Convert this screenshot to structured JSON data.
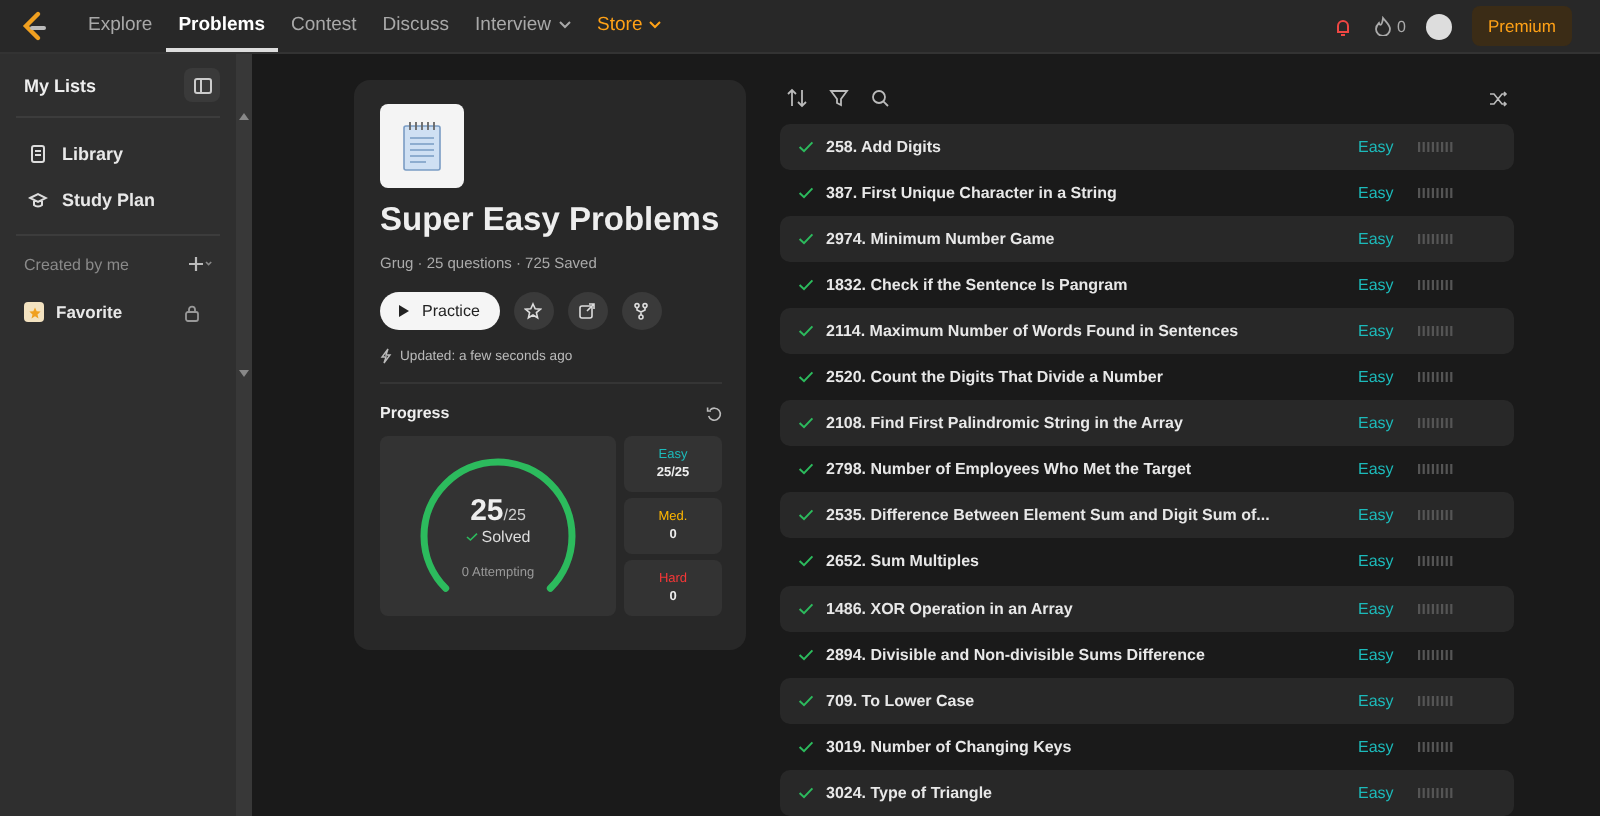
{
  "nav": {
    "items": [
      {
        "label": "Explore",
        "selected": false,
        "dropdown": false,
        "highlight": false
      },
      {
        "label": "Problems",
        "selected": true,
        "dropdown": false,
        "highlight": false
      },
      {
        "label": "Contest",
        "selected": false,
        "dropdown": false,
        "highlight": false
      },
      {
        "label": "Discuss",
        "selected": false,
        "dropdown": false,
        "highlight": false
      },
      {
        "label": "Interview",
        "selected": false,
        "dropdown": true,
        "highlight": false
      },
      {
        "label": "Store",
        "selected": false,
        "dropdown": true,
        "highlight": true
      }
    ],
    "streak": "0",
    "premium": "Premium"
  },
  "sidebar": {
    "title": "My Lists",
    "items": [
      {
        "label": "Library",
        "kind": "library"
      },
      {
        "label": "Study Plan",
        "kind": "studyplan"
      }
    ],
    "section": "Created by me",
    "lists": [
      {
        "label": "Favorite",
        "locked": true
      }
    ]
  },
  "card": {
    "title": "Super Easy Problems",
    "meta": "Grug · 25 questions · 725 Saved",
    "practice": "Practice",
    "updated": "Updated: a few seconds ago",
    "progress": {
      "title": "Progress",
      "solved": "25",
      "total": "/25",
      "solved_label": "Solved",
      "attempting": "0 Attempting",
      "level": 1,
      "counts": [
        {
          "label": "Easy",
          "value": "25/25",
          "color": "#1cbaba"
        },
        {
          "label": "Med.",
          "value": "0",
          "color": "#ffb700"
        },
        {
          "label": "Hard",
          "value": "0",
          "color": "#f63737"
        }
      ]
    }
  },
  "problems": [
    {
      "title": "258. Add Digits",
      "difficulty": "Easy",
      "solved": true
    },
    {
      "title": "387. First Unique Character in a String",
      "difficulty": "Easy",
      "solved": true
    },
    {
      "title": "2974. Minimum Number Game",
      "difficulty": "Easy",
      "solved": true
    },
    {
      "title": "1832. Check if the Sentence Is Pangram",
      "difficulty": "Easy",
      "solved": true
    },
    {
      "title": "2114. Maximum Number of Words Found in Sentences",
      "difficulty": "Easy",
      "solved": true
    },
    {
      "title": "2520. Count the Digits That Divide a Number",
      "difficulty": "Easy",
      "solved": true
    },
    {
      "title": "2108. Find First Palindromic String in the Array",
      "difficulty": "Easy",
      "solved": true
    },
    {
      "title": "2798. Number of Employees Who Met the Target",
      "difficulty": "Easy",
      "solved": true
    },
    {
      "title": "2535. Difference Between Element Sum and Digit Sum of...",
      "difficulty": "Easy",
      "solved": true
    },
    {
      "title": "2652. Sum Multiples",
      "difficulty": "Easy",
      "solved": true
    },
    {
      "title": "1486. XOR Operation in an Array",
      "difficulty": "Easy",
      "solved": true
    },
    {
      "title": "2894. Divisible and Non-divisible Sums Difference",
      "difficulty": "Easy",
      "solved": true
    },
    {
      "title": "709. To Lower Case",
      "difficulty": "Easy",
      "solved": true
    },
    {
      "title": "3019. Number of Changing Keys",
      "difficulty": "Easy",
      "solved": true
    },
    {
      "title": "3024. Type of Triangle",
      "difficulty": "Easy",
      "solved": true
    }
  ]
}
